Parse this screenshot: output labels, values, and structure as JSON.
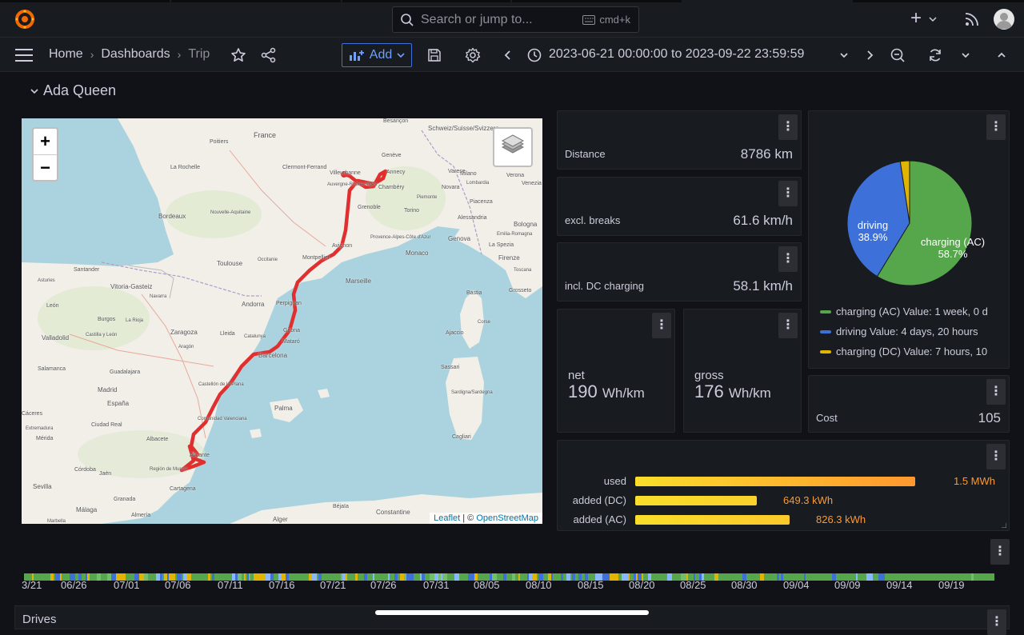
{
  "topbar": {
    "search_placeholder": "Search or jump to...",
    "search_shortcut": "cmd+k",
    "plus_label": "+"
  },
  "navbar": {
    "breadcrumb": [
      "Home",
      "Dashboards",
      "Trip"
    ],
    "add_label": "Add",
    "time_range": "2023-06-21 00:00:00 to 2023-09-22 23:59:59"
  },
  "row_title": "Ada Queen",
  "map": {
    "attribution_leaflet": "Leaflet",
    "attribution_sep": " | © ",
    "attribution_osm": "OpenStreetMap",
    "labels": [
      "France",
      "Schweiz/Suisse/Svizzera",
      "Poitiers",
      "Besançon",
      "Genève",
      "Annecy",
      "Chambéry",
      "Clermont-Ferrand",
      "Villeurbanne",
      "Auvergne-Rhône-Alpes",
      "La Rochelle",
      "Bordeaux",
      "Nouvelle-Aquitaine",
      "Grenoble",
      "Torino",
      "Piemonte",
      "Milano",
      "Lombardia",
      "Varese",
      "Novara",
      "Verona",
      "Venezia",
      "Bologna",
      "Emilia-Romagna",
      "Piacenza",
      "Alessandria",
      "Genova",
      "La Spezia",
      "Firenze",
      "Toscana",
      "Grosseto",
      "Provence-Alpes-Côte d'Azur",
      "Monaco",
      "Toulouse",
      "Occitanie",
      "Montpellier",
      "Avignon",
      "Marseille",
      "Santander",
      "Vitoria-Gasteiz",
      "Asturies",
      "Navarra",
      "León",
      "Burgos",
      "La Rioja",
      "Andorra",
      "Perpignan",
      "Castilla y León",
      "Zaragoza",
      "Aragón",
      "Lleida",
      "Catalunya",
      "Girona",
      "Valladolid",
      "Mataró",
      "Barcelona",
      "Salamanca",
      "Madrid",
      "Guadalajara",
      "Cáceres",
      "Extremadura",
      "Mérida",
      "Ciudad Real",
      "España",
      "Castellón de la Plana",
      "Comunidad Valenciana",
      "Albacete",
      "Alicante",
      "Córdoba",
      "Jaén",
      "Sevilla",
      "Granada",
      "Región de Murcia",
      "Cartagena",
      "Málaga",
      "Almería",
      "Palma",
      "Bastia",
      "Ajaccio",
      "Corse",
      "Sassari",
      "Sardigna/Sardegna",
      "Cagliari",
      "Béjaïa",
      "Constantine",
      "Alger",
      "Marbella"
    ]
  },
  "stats": {
    "distance": {
      "label": "Distance",
      "value": "8786 km"
    },
    "excl_breaks": {
      "label": "excl. breaks",
      "value": "61.6 km/h"
    },
    "incl_dc": {
      "label": "incl. DC charging",
      "value": "58.1 km/h"
    },
    "net": {
      "label": "net",
      "value": "190",
      "unit": "Wh/km"
    },
    "gross": {
      "label": "gross",
      "value": "176",
      "unit": "Wh/km"
    },
    "cost": {
      "label": "Cost",
      "value": "105"
    }
  },
  "chart_data": [
    {
      "type": "pie",
      "slices": [
        {
          "name": "charging (AC)",
          "percent": 58.7,
          "color": "#56a64b",
          "legend": "charging (AC)  Value: 1 week, 0 d"
        },
        {
          "name": "driving",
          "percent": 38.9,
          "color": "#3d71d9",
          "legend": "driving  Value: 4 days, 20 hours"
        },
        {
          "name": "charging (DC)",
          "percent": 2.4,
          "color": "#e0b400",
          "legend": "charging (DC)  Value: 7 hours, 10"
        }
      ]
    },
    {
      "type": "bar",
      "orientation": "horizontal",
      "categories": [
        "used",
        "added (DC)",
        "added (AC)"
      ],
      "values": [
        1.5,
        0.6493,
        0.8263
      ],
      "unit": "MWh",
      "labels": [
        "1.5 MWh",
        "649.3 kWh",
        "826.3 kWh"
      ],
      "xlim": [
        0,
        1.5
      ]
    }
  ],
  "timeline": {
    "ticks": [
      "3/21",
      "06/26",
      "07/01",
      "07/06",
      "07/11",
      "07/16",
      "07/21",
      "07/26",
      "07/31",
      "08/05",
      "08/10",
      "08/15",
      "08/20",
      "08/25",
      "08/30",
      "09/04",
      "09/09",
      "09/14",
      "09/19"
    ]
  },
  "drives_title": "Drives",
  "colors": {
    "accent": "#3d71d9",
    "route": "#e02f2f",
    "bar_orange": "#ff9830"
  }
}
